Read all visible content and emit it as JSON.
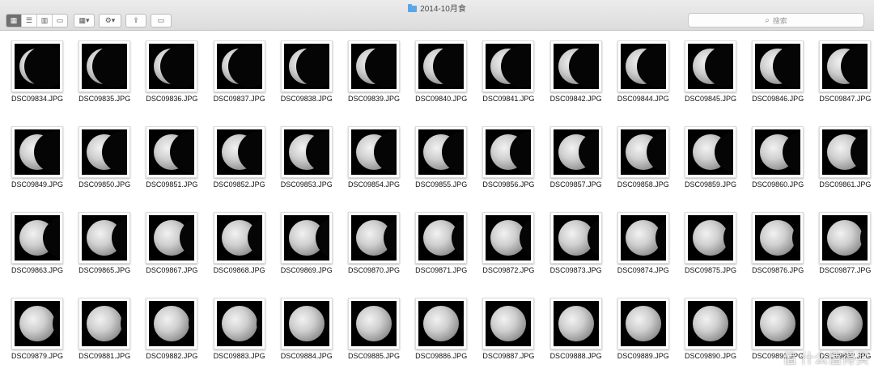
{
  "window": {
    "title": "2014-10月食"
  },
  "toolbar": {
    "view_icons": [
      "icon-view-icon",
      "list-view-icon",
      "column-view-icon",
      "coverflow-view-icon"
    ],
    "search_placeholder": "搜索"
  },
  "files": [
    [
      "DSC09834.JPG",
      "DSC09835.JPG",
      "DSC09836.JPG",
      "DSC09837.JPG",
      "DSC09838.JPG",
      "DSC09839.JPG",
      "DSC09840.JPG",
      "DSC09841.JPG",
      "DSC09842.JPG",
      "DSC09844.JPG",
      "DSC09845.JPG",
      "DSC09846.JPG",
      "DSC09847.JPG"
    ],
    [
      "DSC09849.JPG",
      "DSC09850.JPG",
      "DSC09851.JPG",
      "DSC09852.JPG",
      "DSC09853.JPG",
      "DSC09854.JPG",
      "DSC09855.JPG",
      "DSC09856.JPG",
      "DSC09857.JPG",
      "DSC09858.JPG",
      "DSC09859.JPG",
      "DSC09860.JPG",
      "DSC09861.JPG"
    ],
    [
      "DSC09863.JPG",
      "DSC09865.JPG",
      "DSC09867.JPG",
      "DSC09868.JPG",
      "DSC09869.JPG",
      "DSC09870.JPG",
      "DSC09871.JPG",
      "DSC09872.JPG",
      "DSC09873.JPG",
      "DSC09874.JPG",
      "DSC09875.JPG",
      "DSC09876.JPG",
      "DSC09877.JPG"
    ],
    [
      "DSC09879.JPG",
      "DSC09881.JPG",
      "DSC09882.JPG",
      "DSC09883.JPG",
      "DSC09884.JPG",
      "DSC09885.JPG",
      "DSC09886.JPG",
      "DSC09887.JPG",
      "DSC09888.JPG",
      "DSC09889.JPG",
      "DSC09890.JPG",
      "DSC09891.JPG",
      "DSC09892.JPG"
    ]
  ],
  "watermark": "值 什么值得买"
}
